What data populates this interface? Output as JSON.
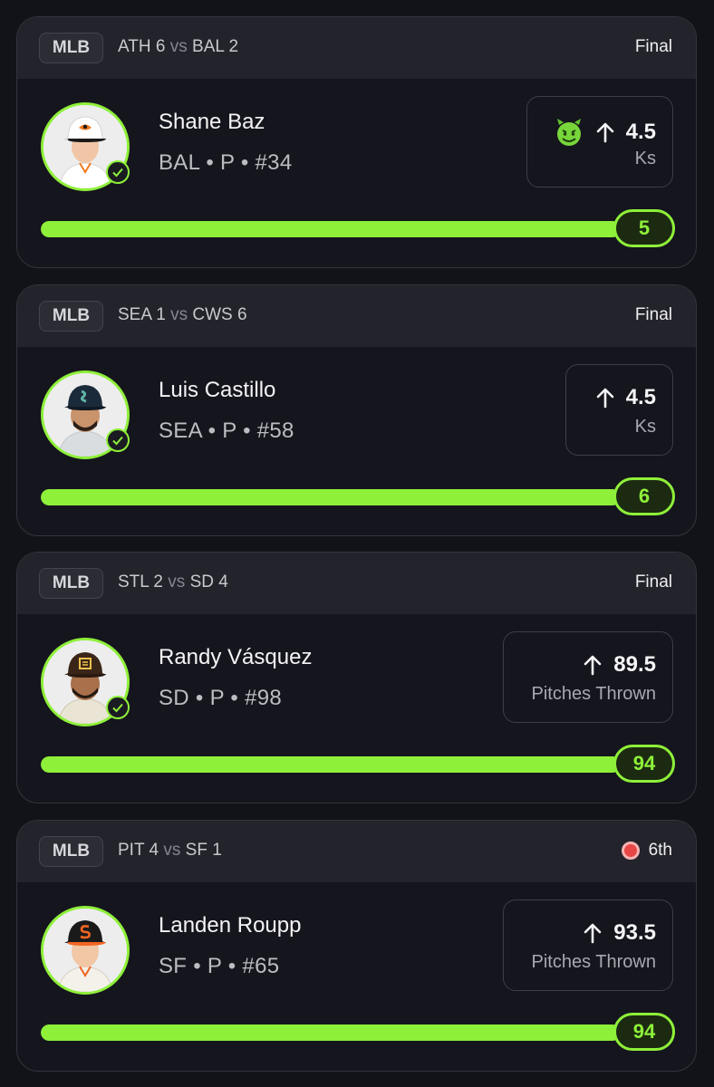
{
  "colors": {
    "accent": "#8ef039",
    "live": "#e84646",
    "background": "#121219"
  },
  "cards": [
    {
      "league": "MLB",
      "away_team": "ATH",
      "away_score": "6",
      "vs": "vs",
      "home_team": "BAL",
      "home_score": "2",
      "status": "Final",
      "live": false,
      "player_name": "Shane Baz",
      "player_meta": "BAL • P • #34",
      "cap_icon": "orioles-cap-icon",
      "line_direction": "up",
      "line": "4.5",
      "stat_unit": "Ks",
      "badge_icon": "devil-emoji-icon",
      "result": "5",
      "progress": 1.0
    },
    {
      "league": "MLB",
      "away_team": "SEA",
      "away_score": "1",
      "vs": "vs",
      "home_team": "CWS",
      "home_score": "6",
      "status": "Final",
      "live": false,
      "player_name": "Luis Castillo",
      "player_meta": "SEA • P • #58",
      "cap_icon": "mariners-cap-icon",
      "line_direction": "up",
      "line": "4.5",
      "stat_unit": "Ks",
      "result": "6",
      "progress": 1.0
    },
    {
      "league": "MLB",
      "away_team": "STL",
      "away_score": "2",
      "vs": "vs",
      "home_team": "SD",
      "home_score": "4",
      "status": "Final",
      "live": false,
      "player_name": "Randy Vásquez",
      "player_meta": "SD • P • #98",
      "cap_icon": "padres-cap-icon",
      "line_direction": "up",
      "line": "89.5",
      "stat_unit": "Pitches Thrown",
      "result": "94",
      "progress": 1.0
    },
    {
      "league": "MLB",
      "away_team": "PIT",
      "away_score": "4",
      "vs": "vs",
      "home_team": "SF",
      "home_score": "1",
      "status": "6th",
      "live": true,
      "player_name": "Landen Roupp",
      "player_meta": "SF • P • #65",
      "cap_icon": "giants-cap-icon",
      "line_direction": "up",
      "line": "93.5",
      "stat_unit": "Pitches Thrown",
      "result": "94",
      "progress": 1.0
    }
  ]
}
